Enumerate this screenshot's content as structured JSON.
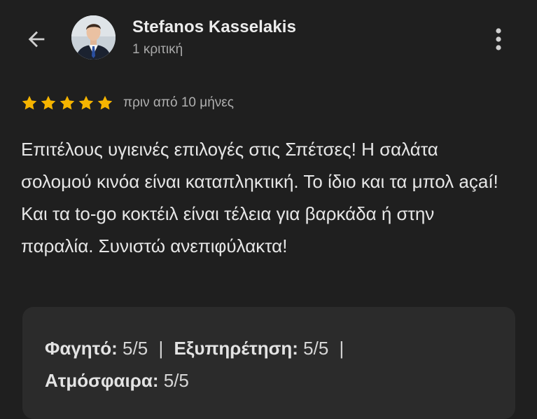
{
  "header": {
    "back_icon": "arrow-left-icon",
    "user_name": "Stefanos Kasselakis",
    "review_count": "1 κριτική",
    "more_icon": "more-vertical-icon"
  },
  "review": {
    "stars": 5,
    "star_max": 5,
    "star_color": "#f5b400",
    "time_ago": "πριν από 10 μήνες",
    "text": "Επιτέλους υγιεινές επιλογές στις Σπέτσες! Η σαλάτα σολομού κινόα είναι καταπληκτική. Το ίδιο και τα μπολ açaí! Και τα to-go κοκτέιλ είναι τέλεια για βαρκάδα ή στην παραλία. Συνιστώ ανεπιφύλακτα!"
  },
  "ratings": {
    "food_label": "Φαγητό:",
    "food_value": "5/5",
    "service_label": "Εξυπηρέτηση:",
    "service_value": "5/5",
    "atmosphere_label": "Ατμόσφαιρα:",
    "atmosphere_value": "5/5",
    "separator": "|"
  },
  "colors": {
    "background": "#1f1f1f",
    "card": "#2b2b2b",
    "star": "#f5b400"
  }
}
